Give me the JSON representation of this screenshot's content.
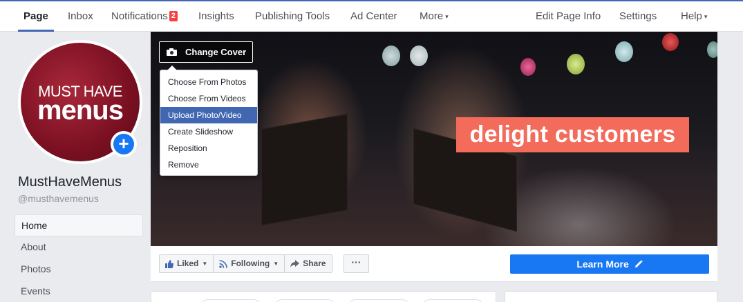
{
  "topnav": {
    "items": [
      {
        "label": "Page",
        "active": true
      },
      {
        "label": "Inbox"
      },
      {
        "label": "Notifications",
        "badge": "2"
      },
      {
        "label": "Insights"
      },
      {
        "label": "Publishing Tools"
      },
      {
        "label": "Ad Center"
      },
      {
        "label": "More",
        "caret": "▾"
      },
      {
        "label": "Edit Page Info"
      },
      {
        "label": "Settings"
      },
      {
        "label": "Help",
        "caret": "▾"
      }
    ]
  },
  "profile": {
    "logo_top": "MUST HAVE",
    "logo_bottom": "menus",
    "name": "MustHaveMenus",
    "handle": "@musthavemenus"
  },
  "leftnav": {
    "items": [
      {
        "label": "Home",
        "active": true
      },
      {
        "label": "About"
      },
      {
        "label": "Photos"
      },
      {
        "label": "Events"
      }
    ]
  },
  "cover": {
    "change_cover_label": "Change Cover",
    "overlay_text": "delight customers",
    "dropdown": [
      {
        "label": "Choose From Photos"
      },
      {
        "label": "Choose From Videos"
      },
      {
        "label": "Upload Photo/Video",
        "highlighted": true
      },
      {
        "label": "Create Slideshow"
      },
      {
        "label": "Reposition"
      },
      {
        "label": "Remove"
      }
    ]
  },
  "actions": {
    "liked": "Liked",
    "following": "Following",
    "share": "Share",
    "more": "···",
    "learn_more": "Learn More"
  },
  "colors": {
    "brand_blue": "#4267b2",
    "cta_blue": "#1877f2",
    "badge_red": "#fa3e3e",
    "overlay_coral": "#f26b5b",
    "logo_maroon": "#7a1022"
  }
}
